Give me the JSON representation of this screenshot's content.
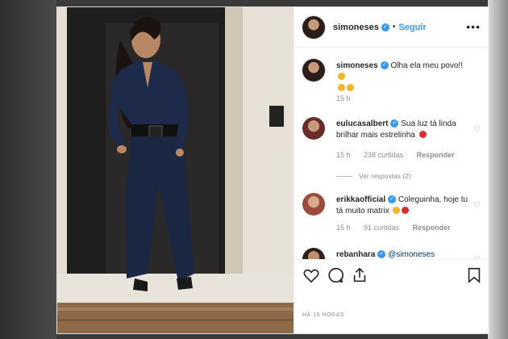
{
  "post": {
    "username": "simoneses",
    "follow_label": "Seguir",
    "more_label": "•••",
    "caption": {
      "username": "simoneses",
      "text": "Olha ela meu povo!!",
      "time": "15 h"
    },
    "comments": [
      {
        "username": "eulucasalbert",
        "text": "Sua luz tá linda brilhar mais estrelinha",
        "time": "15 h",
        "likes": "238 curtidas",
        "reply_label": "Responder",
        "view_replies": "Ver respostas (2)"
      },
      {
        "username": "erikkaofficial",
        "text": "Coleguinha, hoje tu tá muito matrix",
        "time": "15 h",
        "likes": "91 curtidas",
        "reply_label": "Responder"
      },
      {
        "username": "rebanhara",
        "text": "@simoneses"
      }
    ],
    "posted_ago": "HÁ 15 HORAS"
  },
  "colors": {
    "accent": "#3897f0",
    "heart_red": "#d62f2f"
  },
  "icons": [
    "heart-icon",
    "comment-icon",
    "share-icon",
    "bookmark-icon",
    "verified-icon",
    "more-options-icon"
  ]
}
